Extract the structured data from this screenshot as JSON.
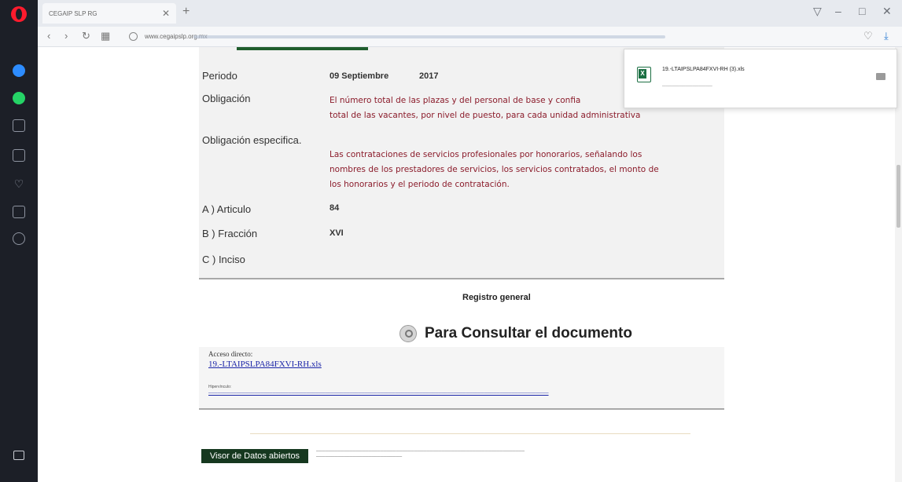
{
  "browser": {
    "tab_title": "CEGAIP SLP RG",
    "url": "www.cegaipslp.org.mx",
    "window_controls": [
      "⊤",
      "–",
      "⧉",
      "✕"
    ]
  },
  "record": {
    "periodo_label": "Periodo",
    "periodo_value": "09 Septiembre",
    "periodo_year": "2017",
    "obligacion_label": "Obligación",
    "obligacion_line1": "El número total de las plazas y del personal de base y confia",
    "obligacion_line2": "total de las vacantes, por nivel de puesto, para cada unidad administrativa",
    "especifica_label": "Obligación especifica.",
    "especifica_line1": "Las contrataciones de servicios profesionales por honorarios, señalando los",
    "especifica_line2": "nombres de los prestadores de servicios, los servicios contratados, el monto de",
    "especifica_line3": "los honorarios y el periodo de contratación.",
    "articulo_label": "A ) Articulo",
    "articulo_value": "84",
    "fraccion_label": "B ) Fracción",
    "fraccion_value": "XVI",
    "inciso_label": "C ) Inciso"
  },
  "registro": {
    "title": "Registro general",
    "consult_heading": "Para Consultar el documento",
    "acceso_label": "Acceso directo:",
    "acceso_link": "19.-LTAIPSLPA84FXVI-RH.xls",
    "hiper_label": "Hipervínculo:"
  },
  "footer": {
    "visor_button": "Visor de Datos abiertos"
  },
  "download": {
    "filename": "19.-LTAIPSLPA84FXVI-RH (3).xls"
  }
}
